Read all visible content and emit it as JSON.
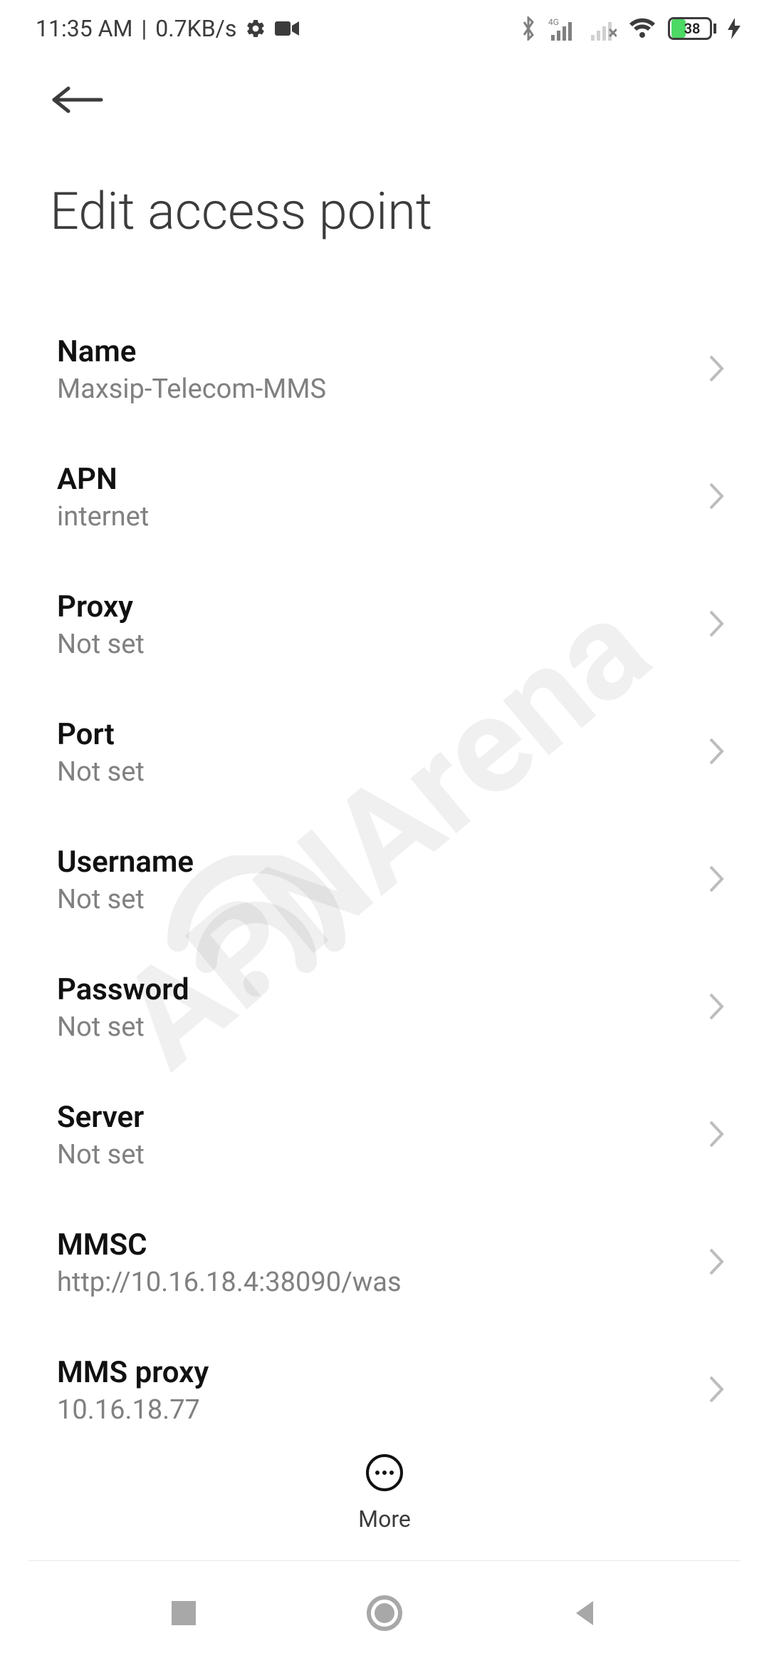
{
  "status_bar": {
    "time": "11:35 AM",
    "net_speed": "0.7KB/s",
    "battery_percent": "38",
    "battery_fill_pct": 38
  },
  "header": {
    "title": "Edit access point"
  },
  "rows": [
    {
      "label": "Name",
      "value": "Maxsip-Telecom-MMS",
      "key": "name"
    },
    {
      "label": "APN",
      "value": "internet",
      "key": "apn"
    },
    {
      "label": "Proxy",
      "value": "Not set",
      "key": "proxy"
    },
    {
      "label": "Port",
      "value": "Not set",
      "key": "port"
    },
    {
      "label": "Username",
      "value": "Not set",
      "key": "username"
    },
    {
      "label": "Password",
      "value": "Not set",
      "key": "password"
    },
    {
      "label": "Server",
      "value": "Not set",
      "key": "server"
    },
    {
      "label": "MMSC",
      "value": "http://10.16.18.4:38090/was",
      "key": "mmsc"
    },
    {
      "label": "MMS proxy",
      "value": "10.16.18.77",
      "key": "mms-proxy"
    }
  ],
  "bottom": {
    "more_label": "More"
  },
  "watermark": "APNArena"
}
